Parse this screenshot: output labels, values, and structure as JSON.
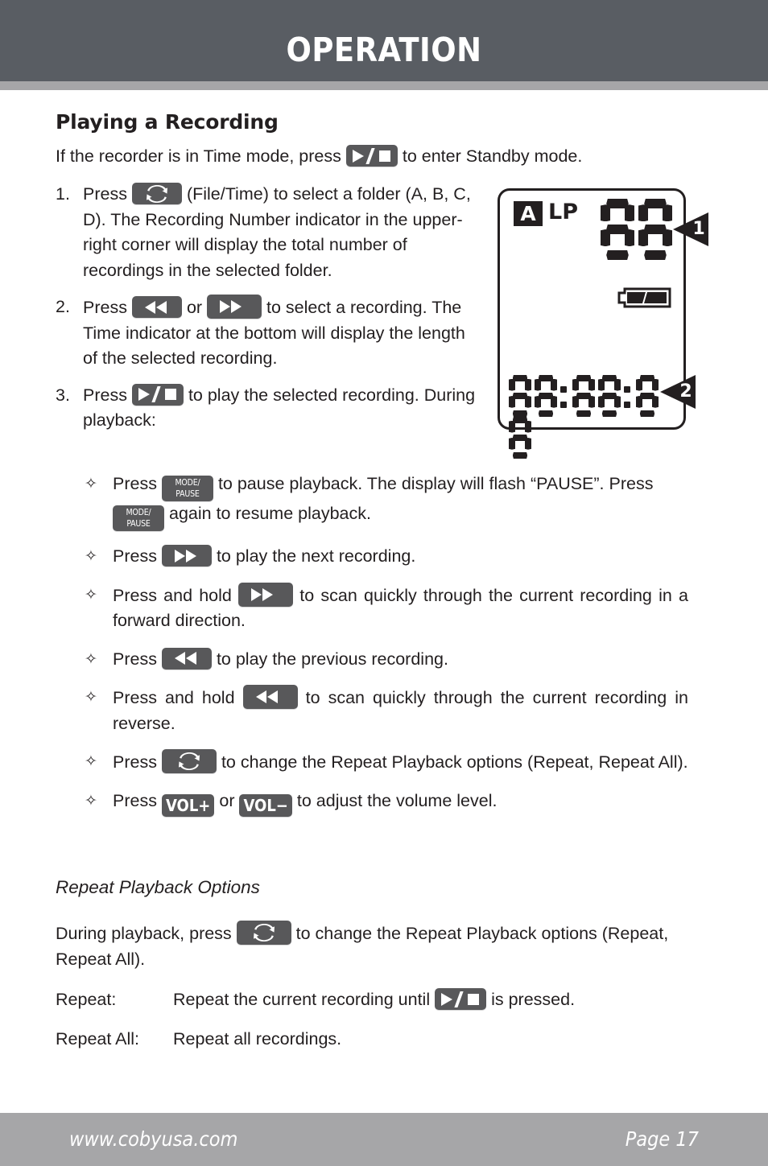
{
  "header": {
    "title": "OPERATION"
  },
  "footer": {
    "site": "www.cobyusa.com",
    "page": "Page 17"
  },
  "content": {
    "section_heading": "Playing a Recording",
    "intro": {
      "before": "If the recorder is in Time mode, press",
      "key": "play-stop",
      "after": "to enter Standby mode."
    },
    "steps": [
      {
        "marker": "1.",
        "before": "Press",
        "key": "repeat",
        "after": "(File/Time) to select a folder (A, B, C, D). The Recording Number indicator in the upper-right corner will display the total number of recordings in the selected folder."
      },
      {
        "marker": "2.",
        "before": "Press",
        "key": "rewind",
        "middle": "or",
        "key2": "fast-forward",
        "after": "to select a recording. The Time indicator at the bottom will display the length of the selected recording."
      },
      {
        "marker": "3.",
        "before": "Press",
        "key": "play-stop",
        "after": "to play the selected recording. During playback:"
      }
    ],
    "bullets": [
      {
        "marker": "✧",
        "before": "Press",
        "key": "mode-pause",
        "middle": "to pause playback. The display will flash “PAUSE”. Press",
        "key2": "mode-pause",
        "after": "again to resume playback."
      },
      {
        "marker": "✧",
        "before": "Press",
        "key": "fast-forward",
        "after": "to play the next recording."
      },
      {
        "marker": "✧",
        "before": "Press and hold",
        "key": "fast-forward",
        "after": "to scan quickly through the current recording in a forward direction."
      },
      {
        "marker": "✧",
        "before": "Press",
        "key": "rewind",
        "after": "to play the previous recording."
      },
      {
        "marker": "✧",
        "before": "Press and hold",
        "key": "rewind",
        "after": "to scan quickly through the current recording in reverse."
      },
      {
        "marker": "✧",
        "before": "Press",
        "key": "repeat",
        "after": "to change the Repeat Playback options (Repeat, Repeat All)."
      },
      {
        "marker": "✧",
        "before": "Press",
        "key": "vol-plus",
        "middle": "or",
        "key2": "vol-minus",
        "after": "to adjust the volume level."
      }
    ],
    "repeat_section": {
      "sub_heading": "Repeat Playback Options",
      "during_before": "During playback, press",
      "during_after": "to change the Repeat Playback options (Repeat, Repeat All).",
      "rows": [
        {
          "term": "Repeat:",
          "before": "Repeat the current recording until",
          "after": "is pressed."
        },
        {
          "term": "Repeat All:",
          "before": "Repeat all recordings.",
          "after": ""
        }
      ]
    }
  },
  "keys": {
    "play_stop_label": "▶/■",
    "repeat_label": "repeat-loop",
    "rewind_label": "◀◀",
    "fast_forward_label": "▶▶",
    "mode_pause_line1": "MODE/",
    "mode_pause_line2": "PAUSE",
    "vol_plus_label": "VOL+",
    "vol_minus_label": "VOL−"
  },
  "lcd": {
    "folder_indicator": "A",
    "quality_indicator": "LP",
    "recording_number": "88",
    "time_indicator": "88:88:88",
    "battery": "battery-full-icon",
    "callouts": [
      {
        "number": "1",
        "refers_to": "recording-number-indicator"
      },
      {
        "number": "2",
        "refers_to": "time-indicator"
      }
    ]
  },
  "colors": {
    "header_bg": "#595d63",
    "band_bg": "#a6a6a8",
    "footer_bg": "#a6a6a8",
    "key_bg": "#58585a",
    "ink": "#231f20"
  }
}
